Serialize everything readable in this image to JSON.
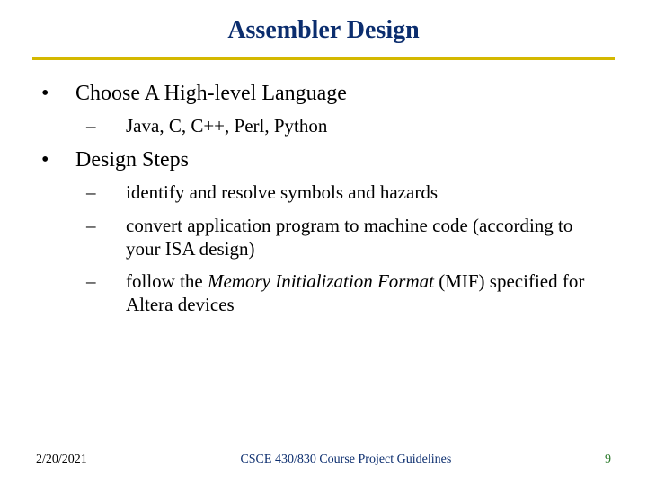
{
  "title": "Assembler Design",
  "bullets": {
    "b1_1": "Choose A High-level Language",
    "b2_1": "Java, C, C++, Perl, Python",
    "b1_2": "Design Steps",
    "b2_2": "identify and resolve symbols and hazards",
    "b2_3": "convert application program to machine code (according to your ISA design)",
    "b2_4a": "follow the ",
    "b2_4b_italic": "Memory Initialization Format",
    "b2_4c": " (MIF) specified for Altera devices"
  },
  "marks": {
    "dot": "•",
    "dash": "–"
  },
  "footer": {
    "date": "2/20/2021",
    "course": "CSCE 430/830 Course Project Guidelines",
    "page": "9"
  }
}
